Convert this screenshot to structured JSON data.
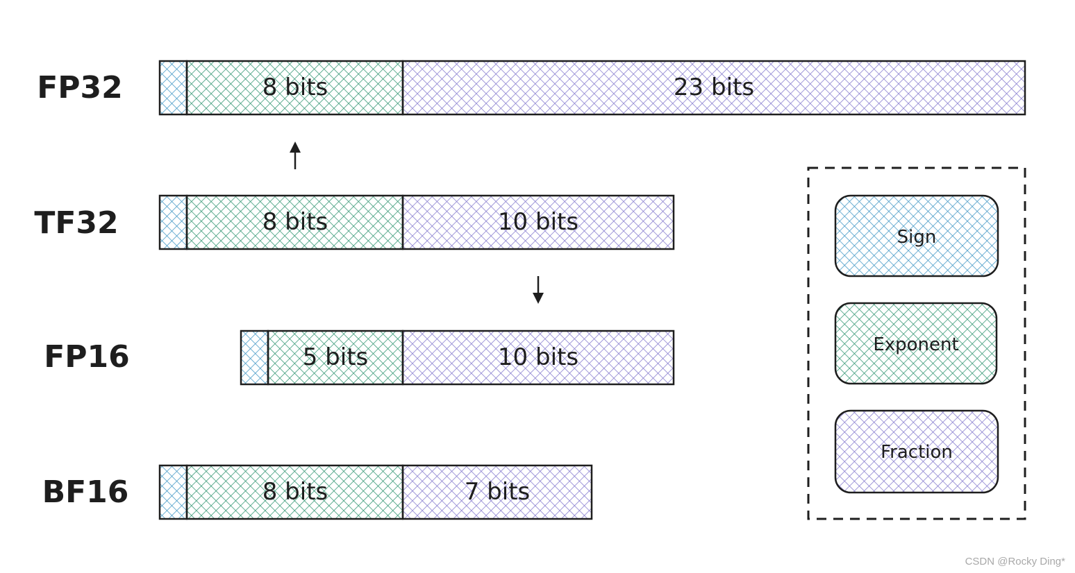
{
  "colors": {
    "sign": "#4a9cc8",
    "exponent": "#3a9a78",
    "fraction": "#8a80d0",
    "stroke": "#1e1e1e"
  },
  "formats": [
    {
      "name": "FP32",
      "exponent": "8 bits",
      "fraction": "23 bits"
    },
    {
      "name": "TF32",
      "exponent": "8 bits",
      "fraction": "10 bits"
    },
    {
      "name": "FP16",
      "exponent": "5 bits",
      "fraction": "10 bits"
    },
    {
      "name": "BF16",
      "exponent": "8 bits",
      "fraction": "7 bits"
    }
  ],
  "arrows": [
    {
      "from": "TF32",
      "to": "FP32",
      "direction": "up"
    },
    {
      "from": "TF32",
      "to": "FP16",
      "direction": "down"
    }
  ],
  "legend": {
    "sign": "Sign",
    "exponent": "Exponent",
    "fraction": "Fraction"
  },
  "watermark": "CSDN @Rocky Ding*"
}
